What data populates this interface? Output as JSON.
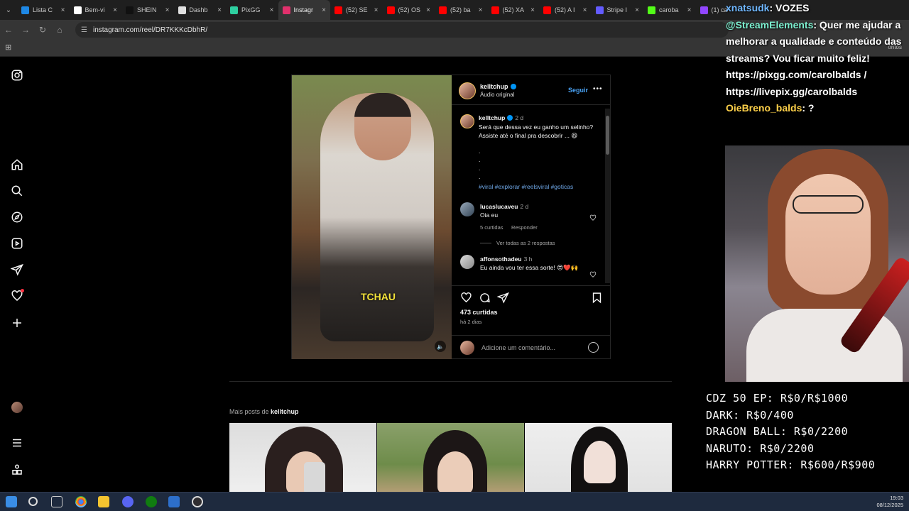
{
  "browser": {
    "tabs": [
      {
        "title": "Lista C",
        "color": "#1e88e5"
      },
      {
        "title": "Bem-vi",
        "color": "#ffffff"
      },
      {
        "title": "SHEIN",
        "color": "#111111"
      },
      {
        "title": "Dashb",
        "color": "#e0e0e0"
      },
      {
        "title": "PixGG",
        "color": "#2ecfa0"
      },
      {
        "title": "Instagr",
        "color": "#e1306c",
        "active": true
      },
      {
        "title": "(52) SE",
        "color": "#ff0000"
      },
      {
        "title": "(52) OS",
        "color": "#ff0000"
      },
      {
        "title": "(52) ba",
        "color": "#ff0000"
      },
      {
        "title": "(52) XA",
        "color": "#ff0000"
      },
      {
        "title": "(52) A I",
        "color": "#ff0000"
      },
      {
        "title": "Stripe I",
        "color": "#635bff"
      },
      {
        "title": "caroba",
        "color": "#53fc18"
      },
      {
        "title": "(1) ca",
        "color": "#9146ff"
      }
    ],
    "url": "instagram.com/reel/DR7KKKcDbhR/",
    "bookmarks_right": "ontos"
  },
  "post": {
    "author": "kelltchup",
    "audio": "Áudio original",
    "follow_label": "Seguir",
    "video_caption_overlay": "TCHAU",
    "caption": {
      "time": "2 d",
      "text": "Será que dessa vez eu ganho um selinho? Assiste até o final pra descobrir ... 😆",
      "dots": [
        ".",
        ".",
        ".",
        "."
      ],
      "hashtags": "#viral #explorar #reelsviral #goticas"
    },
    "comments": [
      {
        "user": "lucaslucaveu",
        "time": "2 d",
        "text": "Oia eu",
        "likes": "5 curtidas",
        "reply": "Responder",
        "view_replies": "Ver todas as 2 respostas"
      },
      {
        "user": "affonsothadeu",
        "time": "3 h",
        "text": "Eu ainda vou ter essa sorte! 😍❤️🙌"
      }
    ],
    "likes": "473 curtidas",
    "posted": "há 2 dias",
    "add_comment_placeholder": "Adicione um comentário..."
  },
  "more_posts": {
    "prefix": "Mais posts de",
    "author": "kelltchup"
  },
  "stream": {
    "chat": [
      {
        "user": "xnatsudk",
        "text": ": VOZES"
      },
      {
        "user": "@StreamElements",
        "text": ": Quer me ajudar a melhorar a qualidade e conteúdo das streams? Vou ficar muito feliz! https://pixgg.com/carolbalds / https://livepix.gg/carolbalds"
      },
      {
        "user": "OieBreno_balds",
        "text": ": ?"
      }
    ],
    "goals": [
      "CDZ 50 EP: R$0/R$1000",
      "DARK: R$0/400",
      "DRAGON BALL: R$0/2200",
      "NARUTO: R$0/2200",
      "HARRY POTTER: R$600/R$900"
    ]
  },
  "taskbar": {
    "time": "19:03",
    "date": "08/12/2025"
  }
}
